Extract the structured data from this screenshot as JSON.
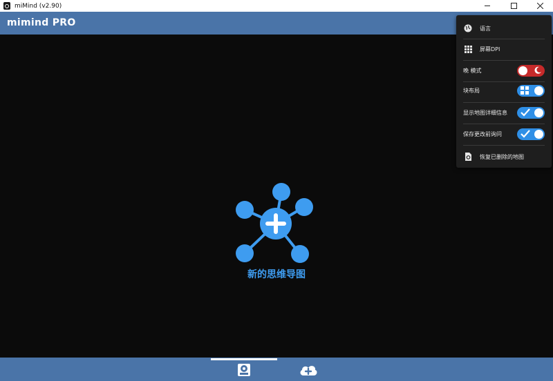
{
  "window": {
    "title": "miMind (v2.90)",
    "controls": [
      "minimize",
      "maximize",
      "close"
    ]
  },
  "header": {
    "logo_text": "mimind PRO"
  },
  "canvas": {
    "new_map_label": "新的思维导图",
    "accent_color": "#3e9cf0"
  },
  "menu": {
    "language_label": "语言",
    "dpi_label": "屏幕DPI",
    "night_mode": {
      "label": "晚 模式",
      "state": "on",
      "icon": "moon-icon",
      "color": "#c62a2a"
    },
    "block_layout": {
      "label": "块布局",
      "state": "on",
      "icon": "grid-icon",
      "color": "#2f8fe6"
    },
    "show_map_details": {
      "label": "显示地图详细信息",
      "state": "on",
      "icon": "check-icon"
    },
    "ask_before_save": {
      "label": "保存更改前询问",
      "state": "on",
      "icon": "check-icon"
    },
    "restore_deleted_label": "恢复已删除的地图"
  },
  "bottom_bar": {
    "tabs": [
      {
        "name": "local",
        "icon": "local-storage-icon",
        "active": true
      },
      {
        "name": "cloud",
        "icon": "cloud-add-icon",
        "active": false
      }
    ],
    "bar_color": "#4a74a8"
  }
}
